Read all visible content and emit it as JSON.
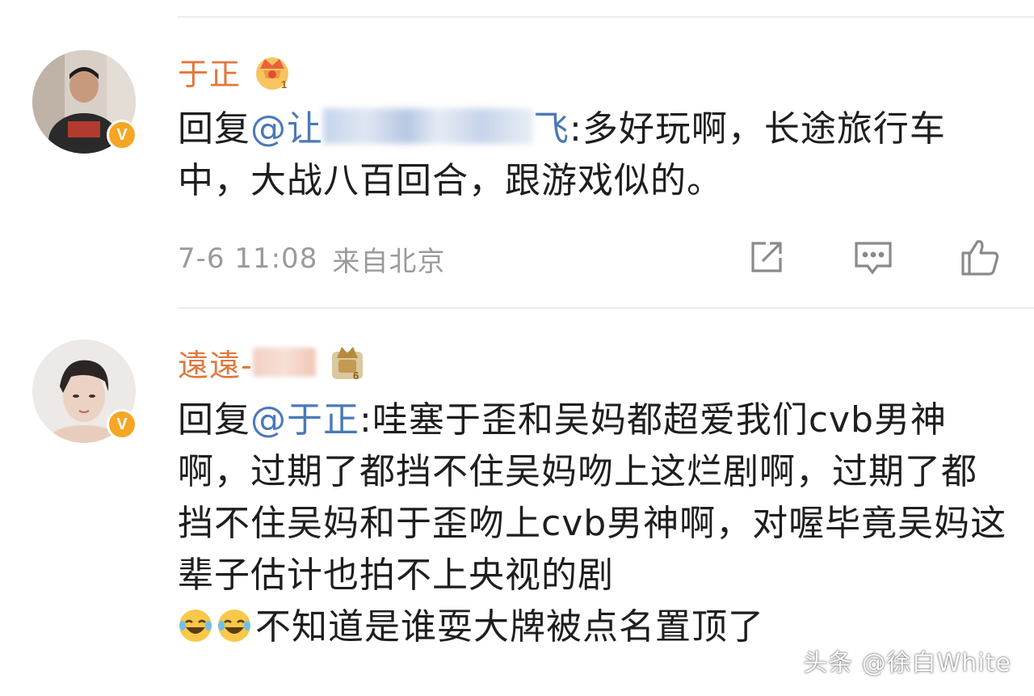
{
  "comments": [
    {
      "username": "于正",
      "level_badge": "1",
      "reply_prefix": "回复",
      "mention_visible_start": "@让",
      "mention_visible_end": "飞",
      "text": ":多好玩啊，长途旅行车中，大战八百回合，跟游戏似的。",
      "date_time": "7-6 11:08",
      "location": "来自北京",
      "actions": [
        "share-icon",
        "comment-icon",
        "like-icon"
      ]
    },
    {
      "username": "遠遠-",
      "level_badge": "6",
      "reply_prefix": "回复",
      "mention": "@于正",
      "text": ":哇塞于歪和吴妈都超爱我们cvb男神啊，过期了都挡不住吴妈吻上这烂剧啊，过期了都挡不住吴妈和于歪吻上cvb男神啊，对喔毕竟吴妈这辈子估计也拍不上央视的剧",
      "text_tail": "不知道是谁耍大牌被点名置顶了"
    }
  ],
  "watermark": "头条 @徐白White",
  "colors": {
    "username": "#e2773c",
    "mention": "#4a79b8",
    "meta": "#9a9a9a",
    "verified": "#f5a623"
  }
}
